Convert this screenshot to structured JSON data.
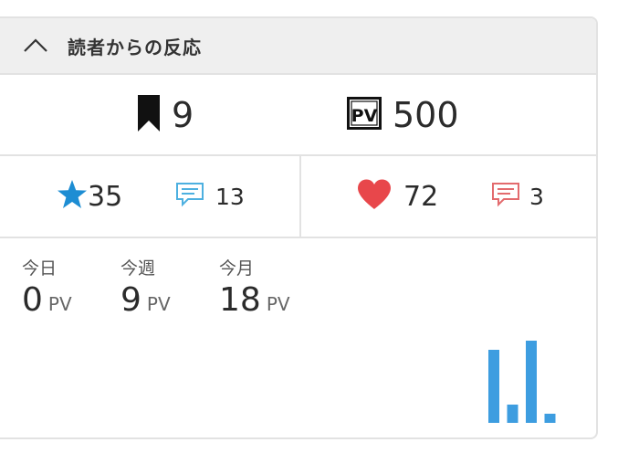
{
  "header": {
    "title": "読者からの反応",
    "toggle_icon": "chevron-up-icon"
  },
  "totals": {
    "bookmarks": "9",
    "bookmark_icon": "bookmark-icon",
    "pv_badge": "PV",
    "pv": "500"
  },
  "reactions": {
    "stars": "35",
    "star_icon": "star-icon",
    "star_color": "#1d8dd3",
    "star_comments": "13",
    "star_comment_color": "#4db0e0",
    "likes": "72",
    "heart_icon": "heart-icon",
    "heart_color": "#e8474b",
    "like_comments": "3",
    "like_comment_color": "#e36b6e"
  },
  "pageviews": {
    "today_label": "今日",
    "today_value": "0",
    "week_label": "今週",
    "week_value": "9",
    "month_label": "今月",
    "month_value": "18",
    "unit": "PV"
  },
  "chart_data": {
    "type": "bar",
    "color": "#3d9de0",
    "values": [
      8,
      2,
      9,
      1
    ]
  }
}
